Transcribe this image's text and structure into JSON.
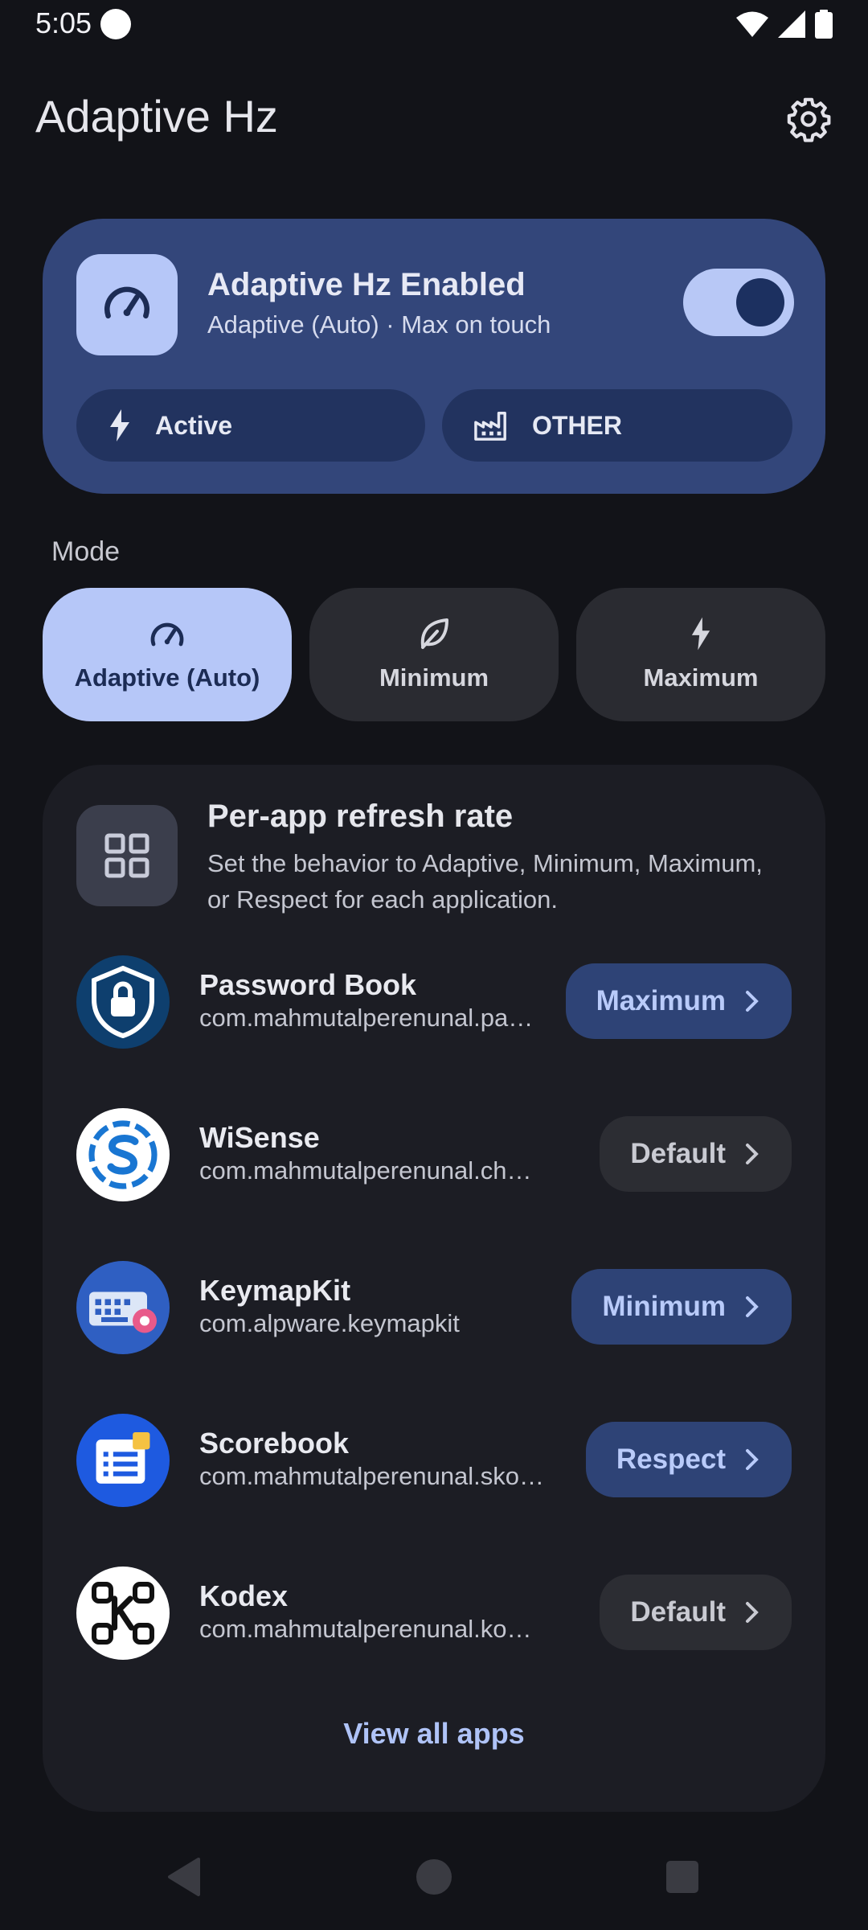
{
  "status_bar": {
    "time": "5:05"
  },
  "header": {
    "title": "Adaptive Hz"
  },
  "status_card": {
    "title": "Adaptive Hz Enabled",
    "subtitle": "Adaptive (Auto) · Max on touch",
    "toggle_on": true,
    "chips": [
      {
        "label": "Active"
      },
      {
        "label": "OTHER"
      }
    ]
  },
  "mode": {
    "label": "Mode",
    "options": [
      {
        "label": "Adaptive (Auto)",
        "selected": true
      },
      {
        "label": "Minimum",
        "selected": false
      },
      {
        "label": "Maximum",
        "selected": false
      }
    ]
  },
  "per_app": {
    "title": "Per-app refresh rate",
    "description": "Set the behavior to Adaptive, Minimum, Maximum, or Respect for each application.",
    "apps": [
      {
        "name": "Password Book",
        "package": "com.mahmutalperenunal.passwordbook",
        "mode": "Maximum",
        "style": "accent"
      },
      {
        "name": "WiSense",
        "package": "com.mahmutalperenunal.changer",
        "mode": "Default",
        "style": "neutral"
      },
      {
        "name": "KeymapKit",
        "package": "com.alpware.keymapkit",
        "mode": "Minimum",
        "style": "accent"
      },
      {
        "name": "Scorebook",
        "package": "com.mahmutalperenunal.skorbook",
        "mode": "Respect",
        "style": "accent"
      },
      {
        "name": "Kodex",
        "package": "com.mahmutalperenunal.kodex",
        "mode": "Default",
        "style": "neutral"
      }
    ],
    "view_all": "View all apps"
  },
  "colors": {
    "accent": "#B6C7F8",
    "card": "#33467A",
    "background": "#121318"
  }
}
